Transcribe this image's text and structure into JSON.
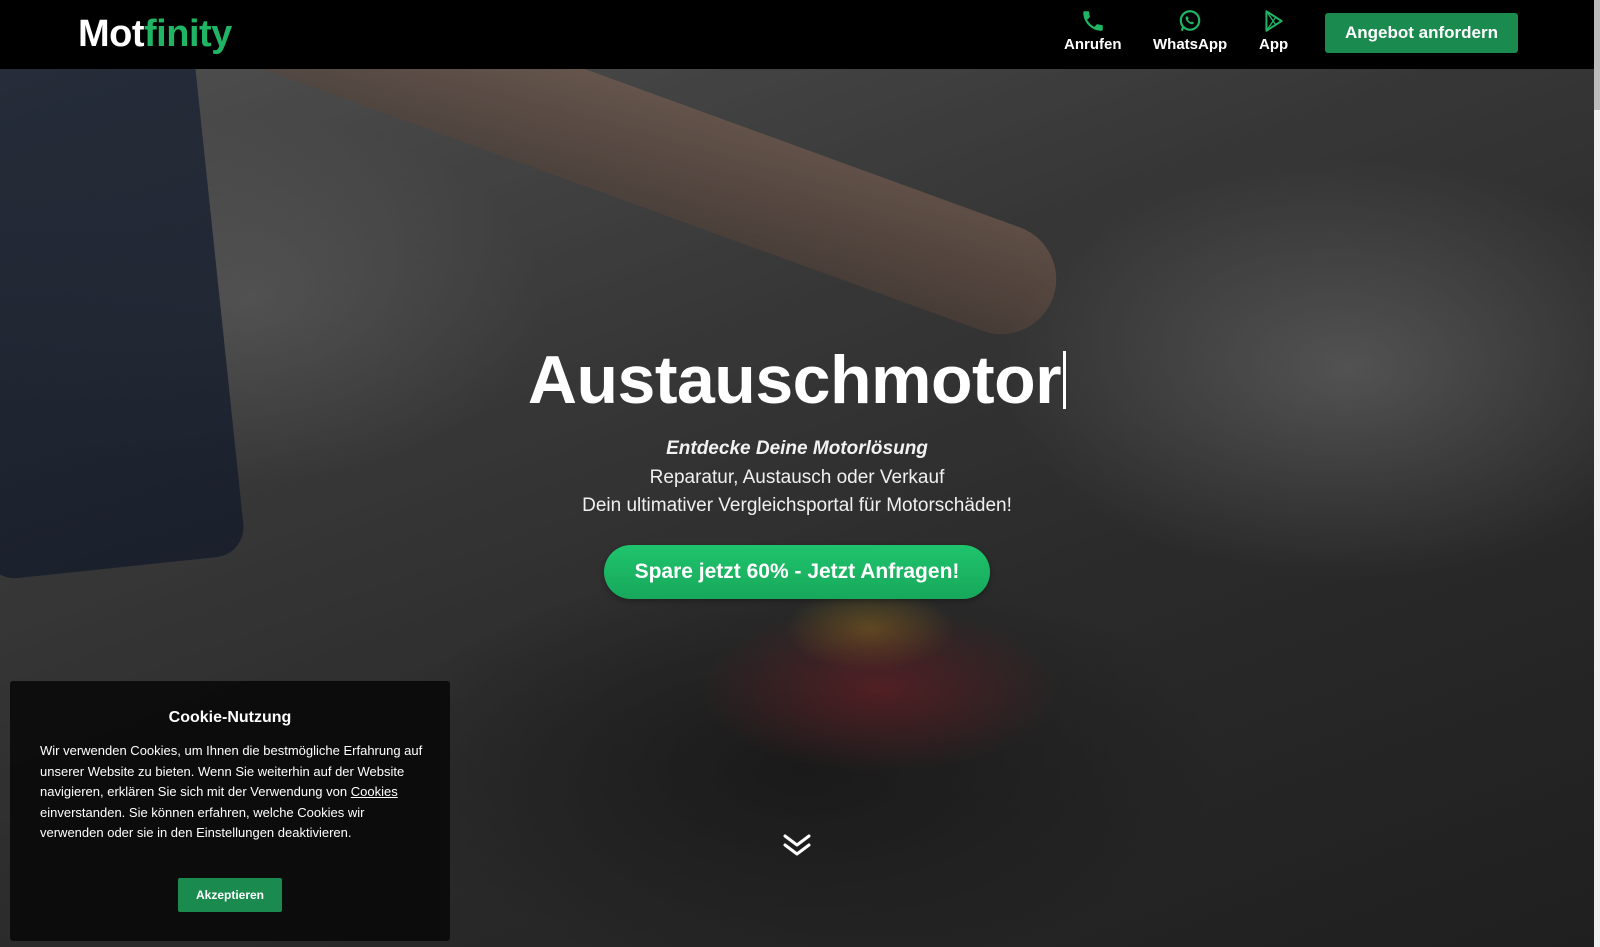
{
  "brand": {
    "part1": "Mot",
    "part2": "finity"
  },
  "nav": {
    "call_label": "Anrufen",
    "whatsapp_label": "WhatsApp",
    "app_label": "App",
    "cta_label": "Angebot anfordern"
  },
  "hero": {
    "title": "Austauschmotor",
    "tagline": "Entdecke Deine Motorlösung",
    "line2": "Reparatur, Austausch oder Verkauf",
    "line3": "Dein ultimativer Vergleichsportal für Motorschäden!",
    "cta_label": "Spare jetzt 60% - Jetzt Anfragen!"
  },
  "cookie": {
    "title": "Cookie-Nutzung",
    "text_before": "Wir verwenden Cookies, um Ihnen die bestmögliche Erfahrung auf unserer Website zu bieten. Wenn Sie weiterhin auf der Website navigieren, erklären Sie sich mit der Verwendung von ",
    "link_label": "Cookies",
    "text_after": " einverstanden. Sie können erfahren, welche Cookies wir verwenden oder sie in den Einstellungen deaktivieren.",
    "accept_label": "Akzeptieren"
  },
  "colors": {
    "accent": "#1fb565",
    "button": "#1a8a4f",
    "header_bg": "#000000"
  },
  "icons": [
    "phone-icon",
    "whatsapp-icon",
    "play-store-icon",
    "double-chevron-down-icon"
  ]
}
